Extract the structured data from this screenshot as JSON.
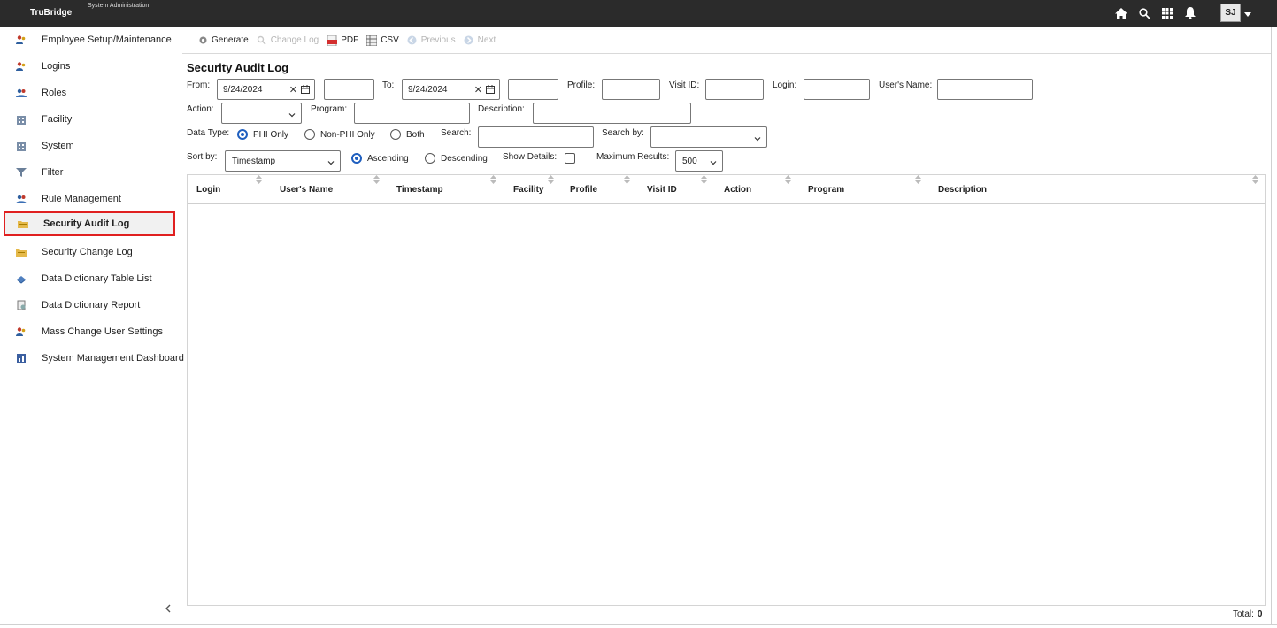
{
  "header": {
    "brand": "TruBridge",
    "section": "System Administration",
    "title": "Security Audit Log",
    "user_initials": "SJ",
    "icons": [
      "home-icon",
      "search-icon",
      "apps-grid-icon",
      "bell-icon",
      "chevron-down-icon"
    ]
  },
  "sidebar": {
    "items": [
      {
        "label": "Employee Setup/Maintenance",
        "icon": "users-icon"
      },
      {
        "label": "Logins",
        "icon": "users-icon"
      },
      {
        "label": "Roles",
        "icon": "roles-icon"
      },
      {
        "label": "Facility",
        "icon": "building-icon"
      },
      {
        "label": "System",
        "icon": "building-icon"
      },
      {
        "label": "Filter",
        "icon": "filter-icon"
      },
      {
        "label": "Rule Management",
        "icon": "roles-icon"
      },
      {
        "label": "Security Audit Log",
        "icon": "folder-icon",
        "active": true
      },
      {
        "label": "Security Change Log",
        "icon": "folder-icon"
      },
      {
        "label": "Data Dictionary Table List",
        "icon": "table-icon"
      },
      {
        "label": "Data Dictionary Report",
        "icon": "report-icon"
      },
      {
        "label": "Mass Change User Settings",
        "icon": "users-icon"
      },
      {
        "label": "System Management Dashboard",
        "icon": "dashboard-icon"
      }
    ]
  },
  "toolbar": {
    "generate": "Generate",
    "change_log": "Change Log",
    "pdf": "PDF",
    "csv": "CSV",
    "previous": "Previous",
    "next": "Next"
  },
  "form": {
    "title": "Security Audit Log",
    "from_label": "From:",
    "from_date": "9/24/2024",
    "from_time": "",
    "to_label": "To:",
    "to_date": "9/24/2024",
    "to_time": "",
    "profile_label": "Profile:",
    "profile_value": "",
    "visit_id_label": "Visit ID:",
    "visit_id_value": "",
    "login_label": "Login:",
    "login_value": "",
    "users_name_label": "User's Name:",
    "users_name_value": "",
    "action_label": "Action:",
    "action_value": "",
    "program_label": "Program:",
    "program_value": "",
    "description_label": "Description:",
    "description_value": "",
    "data_type_label": "Data Type:",
    "data_type_options": [
      "PHI Only",
      "Non-PHI Only",
      "Both"
    ],
    "data_type_selected": "PHI Only",
    "search_label": "Search:",
    "search_value": "",
    "search_by_label": "Search by:",
    "search_by_value": "",
    "sort_by_label": "Sort by:",
    "sort_by_value": "Timestamp",
    "order_options": [
      "Ascending",
      "Descending"
    ],
    "order_selected": "Ascending",
    "show_details_label": "Show Details:",
    "show_details_checked": false,
    "max_results_label": "Maximum Results:",
    "max_results_value": "500"
  },
  "grid": {
    "columns": [
      "Login",
      "User's Name",
      "Timestamp",
      "Facility",
      "Profile",
      "Visit ID",
      "Action",
      "Program",
      "Description"
    ],
    "rows": []
  },
  "footer": {
    "total_label": "Total:",
    "total_value": "0"
  }
}
